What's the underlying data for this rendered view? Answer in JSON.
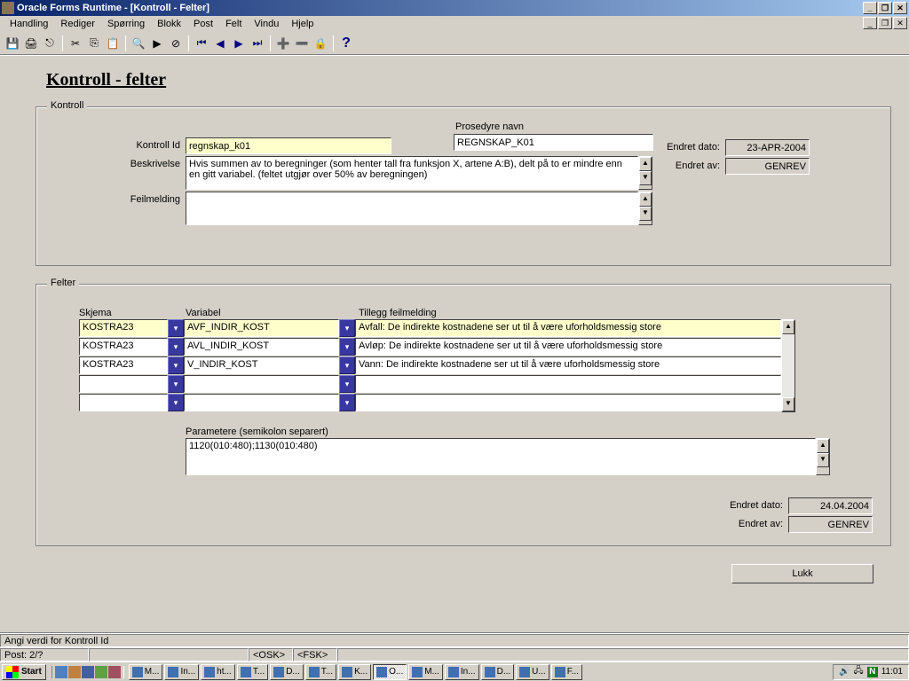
{
  "window": {
    "title": "Oracle Forms Runtime - [Kontroll - Felter]"
  },
  "menu": {
    "items": [
      "Handling",
      "Rediger",
      "Spørring",
      "Blokk",
      "Post",
      "Felt",
      "Vindu",
      "Hjelp"
    ]
  },
  "page": {
    "title": "Kontroll - felter"
  },
  "kontroll": {
    "legend": "Kontroll",
    "kontroll_id_label": "Kontroll Id",
    "kontroll_id": "regnskap_k01",
    "prosedyre_label": "Prosedyre navn",
    "prosedyre": "REGNSKAP_K01",
    "beskrivelse_label": "Beskrivelse",
    "beskrivelse": "Hvis summen av to beregninger (som henter tall fra funksjon X, artene A:B), delt på to er mindre enn en gitt variabel. (feltet utgjør over 50% av beregningen)",
    "feilmelding_label": "Feilmelding",
    "feilmelding": "",
    "endret_dato_label": "Endret dato:",
    "endret_dato": "23-APR-2004",
    "endret_av_label": "Endret av:",
    "endret_av": "GENREV"
  },
  "felter": {
    "legend": "Felter",
    "headers": {
      "skjema": "Skjema",
      "variabel": "Variabel",
      "tillegg": "Tillegg feilmelding"
    },
    "rows": [
      {
        "skjema": "KOSTRA23",
        "variabel": "AVF_INDIR_KOST",
        "tillegg": "Avfall: De indirekte kostnadene ser ut til å være uforholdsmessig store"
      },
      {
        "skjema": "KOSTRA23",
        "variabel": "AVL_INDIR_KOST",
        "tillegg": "Avløp: De indirekte kostnadene ser ut til å være uforholdsmessig store"
      },
      {
        "skjema": "KOSTRA23",
        "variabel": "V_INDIR_KOST",
        "tillegg": "Vann: De indirekte kostnadene ser ut til å være uforholdsmessig store"
      },
      {
        "skjema": "",
        "variabel": "",
        "tillegg": ""
      },
      {
        "skjema": "",
        "variabel": "",
        "tillegg": ""
      }
    ],
    "parametere_label": "Parametere (semikolon separert)",
    "parametere": "1120(010:480);1130(010:480)",
    "endret_dato_label": "Endret dato:",
    "endret_dato": "24.04.2004",
    "endret_av_label": "Endret av:",
    "endret_av": "GENREV"
  },
  "buttons": {
    "lukk": "Lukk"
  },
  "status": {
    "msg": "Angi verdi for Kontroll Id",
    "post": "Post: 2/?",
    "ind1": "<OSK>",
    "ind2": "<FSK>"
  },
  "taskbar": {
    "start": "Start",
    "items": [
      "M...",
      "In...",
      "ht...",
      "T...",
      "D...",
      "T...",
      "K...",
      "O...",
      "M...",
      "In...",
      "D...",
      "U...",
      "F..."
    ],
    "active_index": 7,
    "clock": "11:01"
  }
}
